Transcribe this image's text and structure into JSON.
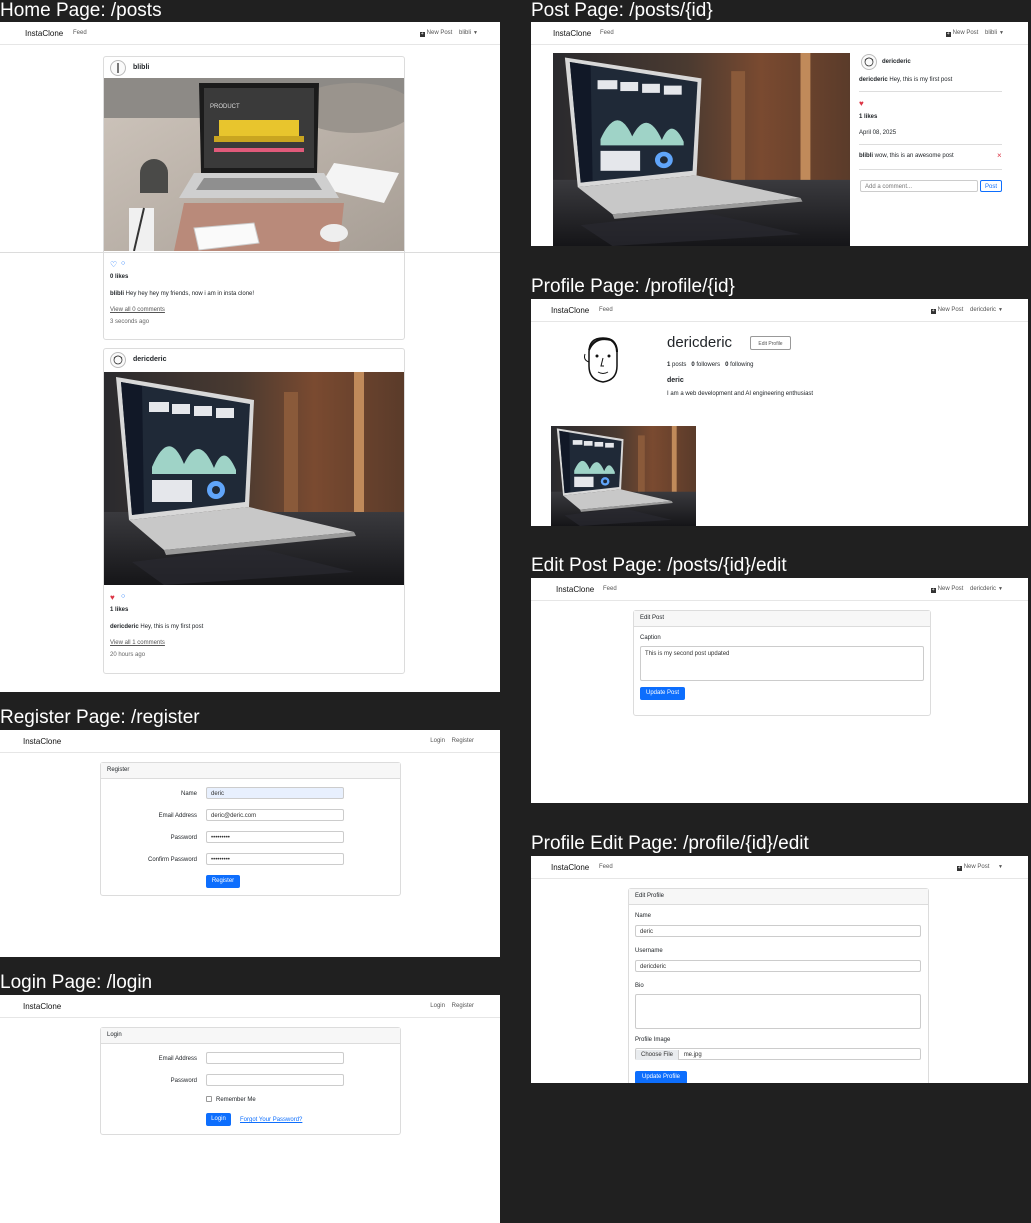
{
  "app": {
    "brand": "InstaClone",
    "feed": "Feed",
    "new_post": "New Post",
    "login": "Login",
    "register": "Register",
    "colors": {
      "primary": "#0d6efd",
      "background": "#202020",
      "heart": "#dc3545"
    }
  },
  "captions": {
    "home": "Home Page: /posts",
    "post": "Post Page: /posts/{id}",
    "profile": "Profile Page: /profile/{id}",
    "edit_post": "Edit Post Page: /posts/{id}/edit",
    "register": "Register Page: /register",
    "login": "Login Page: /login",
    "profile_edit": "Profile Edit Page: /profile/{id}/edit"
  },
  "home": {
    "user_menu": "blibli",
    "posts": [
      {
        "username": "blibli",
        "likes": "0 likes",
        "caption": "Hey hey hey my friends, now i am in insta clone!",
        "comments_link": "View all 0 comments",
        "time": "3 seconds ago",
        "image": "laptop-product"
      },
      {
        "username": "dericderic",
        "likes": "1 likes",
        "caption": "Hey, this is my first post",
        "comments_link": "View all 1 comments",
        "time": "20 hours ago",
        "image": "laptop-dashboard"
      }
    ]
  },
  "post_page": {
    "user_menu": "blibli",
    "username": "dericderic",
    "caption_user": "dericderic",
    "caption": "Hey, this is my first post",
    "likes": "1 likes",
    "date": "April 08, 2025",
    "comment_user": "blibli",
    "comment": "wow, this is an awesome post",
    "delete_symbol": "×",
    "comment_placeholder": "Add a comment...",
    "post_button": "Post"
  },
  "profile": {
    "user_menu": "dericderic",
    "username": "dericderic",
    "edit_button": "Edit Profile",
    "posts_count": "1",
    "posts_label": "posts",
    "followers_count": "0",
    "followers_label": "followers",
    "following_count": "0",
    "following_label": "following",
    "name": "deric",
    "bio": "I am a web development and AI engineering enthusiast"
  },
  "edit_post": {
    "user_menu": "dericderic",
    "card_title": "Edit Post",
    "caption_label": "Caption",
    "caption_value": "This is my second post updated",
    "button": "Update Post"
  },
  "register": {
    "card_title": "Register",
    "name_label": "Name",
    "name_value": "deric",
    "email_label": "Email Address",
    "email_value": "deric@deric.com",
    "password_label": "Password",
    "password_value": "•••••••••",
    "confirm_label": "Confirm Password",
    "confirm_value": "•••••••••",
    "button": "Register"
  },
  "login": {
    "card_title": "Login",
    "email_label": "Email Address",
    "password_label": "Password",
    "remember": "Remember Me",
    "button": "Login",
    "forgot": "Forgot Your Password?"
  },
  "profile_edit": {
    "card_title": "Edit Profile",
    "name_label": "Name",
    "name_value": "deric",
    "username_label": "Username",
    "username_value": "dericderic",
    "bio_label": "Bio",
    "image_label": "Profile Image",
    "choose_file": "Choose File",
    "file_name": "me.jpg",
    "button": "Update Profile"
  }
}
